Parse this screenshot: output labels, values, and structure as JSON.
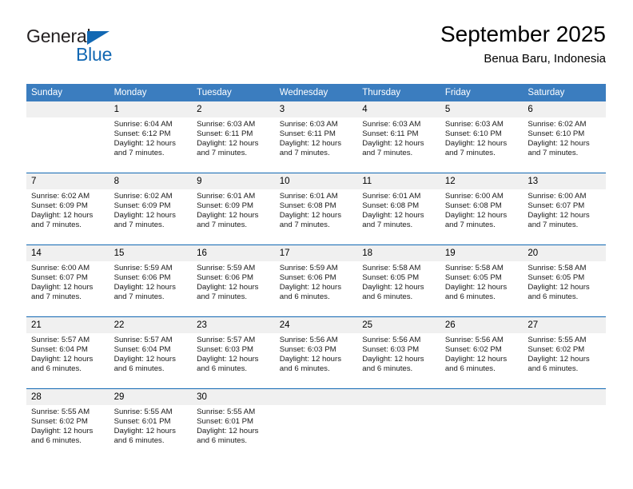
{
  "brand": {
    "word_one": "General",
    "word_two": "Blue",
    "triangle_icon": "blue-triangle-logo-mark",
    "accent_color": "#1268b3"
  },
  "header": {
    "title": "September 2025",
    "subtitle": "Benua Baru, Indonesia"
  },
  "calendar": {
    "header_bg": "#3b7dbf",
    "daynum_bg": "#f0f0f0",
    "weekday_headers": [
      "Sunday",
      "Monday",
      "Tuesday",
      "Wednesday",
      "Thursday",
      "Friday",
      "Saturday"
    ],
    "weeks": [
      [
        {
          "day": "",
          "lines": []
        },
        {
          "day": "1",
          "lines": [
            "Sunrise: 6:04 AM",
            "Sunset: 6:12 PM",
            "Daylight: 12 hours",
            "and 7 minutes."
          ]
        },
        {
          "day": "2",
          "lines": [
            "Sunrise: 6:03 AM",
            "Sunset: 6:11 PM",
            "Daylight: 12 hours",
            "and 7 minutes."
          ]
        },
        {
          "day": "3",
          "lines": [
            "Sunrise: 6:03 AM",
            "Sunset: 6:11 PM",
            "Daylight: 12 hours",
            "and 7 minutes."
          ]
        },
        {
          "day": "4",
          "lines": [
            "Sunrise: 6:03 AM",
            "Sunset: 6:11 PM",
            "Daylight: 12 hours",
            "and 7 minutes."
          ]
        },
        {
          "day": "5",
          "lines": [
            "Sunrise: 6:03 AM",
            "Sunset: 6:10 PM",
            "Daylight: 12 hours",
            "and 7 minutes."
          ]
        },
        {
          "day": "6",
          "lines": [
            "Sunrise: 6:02 AM",
            "Sunset: 6:10 PM",
            "Daylight: 12 hours",
            "and 7 minutes."
          ]
        }
      ],
      [
        {
          "day": "7",
          "lines": [
            "Sunrise: 6:02 AM",
            "Sunset: 6:09 PM",
            "Daylight: 12 hours",
            "and 7 minutes."
          ]
        },
        {
          "day": "8",
          "lines": [
            "Sunrise: 6:02 AM",
            "Sunset: 6:09 PM",
            "Daylight: 12 hours",
            "and 7 minutes."
          ]
        },
        {
          "day": "9",
          "lines": [
            "Sunrise: 6:01 AM",
            "Sunset: 6:09 PM",
            "Daylight: 12 hours",
            "and 7 minutes."
          ]
        },
        {
          "day": "10",
          "lines": [
            "Sunrise: 6:01 AM",
            "Sunset: 6:08 PM",
            "Daylight: 12 hours",
            "and 7 minutes."
          ]
        },
        {
          "day": "11",
          "lines": [
            "Sunrise: 6:01 AM",
            "Sunset: 6:08 PM",
            "Daylight: 12 hours",
            "and 7 minutes."
          ]
        },
        {
          "day": "12",
          "lines": [
            "Sunrise: 6:00 AM",
            "Sunset: 6:08 PM",
            "Daylight: 12 hours",
            "and 7 minutes."
          ]
        },
        {
          "day": "13",
          "lines": [
            "Sunrise: 6:00 AM",
            "Sunset: 6:07 PM",
            "Daylight: 12 hours",
            "and 7 minutes."
          ]
        }
      ],
      [
        {
          "day": "14",
          "lines": [
            "Sunrise: 6:00 AM",
            "Sunset: 6:07 PM",
            "Daylight: 12 hours",
            "and 7 minutes."
          ]
        },
        {
          "day": "15",
          "lines": [
            "Sunrise: 5:59 AM",
            "Sunset: 6:06 PM",
            "Daylight: 12 hours",
            "and 7 minutes."
          ]
        },
        {
          "day": "16",
          "lines": [
            "Sunrise: 5:59 AM",
            "Sunset: 6:06 PM",
            "Daylight: 12 hours",
            "and 7 minutes."
          ]
        },
        {
          "day": "17",
          "lines": [
            "Sunrise: 5:59 AM",
            "Sunset: 6:06 PM",
            "Daylight: 12 hours",
            "and 6 minutes."
          ]
        },
        {
          "day": "18",
          "lines": [
            "Sunrise: 5:58 AM",
            "Sunset: 6:05 PM",
            "Daylight: 12 hours",
            "and 6 minutes."
          ]
        },
        {
          "day": "19",
          "lines": [
            "Sunrise: 5:58 AM",
            "Sunset: 6:05 PM",
            "Daylight: 12 hours",
            "and 6 minutes."
          ]
        },
        {
          "day": "20",
          "lines": [
            "Sunrise: 5:58 AM",
            "Sunset: 6:05 PM",
            "Daylight: 12 hours",
            "and 6 minutes."
          ]
        }
      ],
      [
        {
          "day": "21",
          "lines": [
            "Sunrise: 5:57 AM",
            "Sunset: 6:04 PM",
            "Daylight: 12 hours",
            "and 6 minutes."
          ]
        },
        {
          "day": "22",
          "lines": [
            "Sunrise: 5:57 AM",
            "Sunset: 6:04 PM",
            "Daylight: 12 hours",
            "and 6 minutes."
          ]
        },
        {
          "day": "23",
          "lines": [
            "Sunrise: 5:57 AM",
            "Sunset: 6:03 PM",
            "Daylight: 12 hours",
            "and 6 minutes."
          ]
        },
        {
          "day": "24",
          "lines": [
            "Sunrise: 5:56 AM",
            "Sunset: 6:03 PM",
            "Daylight: 12 hours",
            "and 6 minutes."
          ]
        },
        {
          "day": "25",
          "lines": [
            "Sunrise: 5:56 AM",
            "Sunset: 6:03 PM",
            "Daylight: 12 hours",
            "and 6 minutes."
          ]
        },
        {
          "day": "26",
          "lines": [
            "Sunrise: 5:56 AM",
            "Sunset: 6:02 PM",
            "Daylight: 12 hours",
            "and 6 minutes."
          ]
        },
        {
          "day": "27",
          "lines": [
            "Sunrise: 5:55 AM",
            "Sunset: 6:02 PM",
            "Daylight: 12 hours",
            "and 6 minutes."
          ]
        }
      ],
      [
        {
          "day": "28",
          "lines": [
            "Sunrise: 5:55 AM",
            "Sunset: 6:02 PM",
            "Daylight: 12 hours",
            "and 6 minutes."
          ]
        },
        {
          "day": "29",
          "lines": [
            "Sunrise: 5:55 AM",
            "Sunset: 6:01 PM",
            "Daylight: 12 hours",
            "and 6 minutes."
          ]
        },
        {
          "day": "30",
          "lines": [
            "Sunrise: 5:55 AM",
            "Sunset: 6:01 PM",
            "Daylight: 12 hours",
            "and 6 minutes."
          ]
        },
        {
          "day": "",
          "lines": []
        },
        {
          "day": "",
          "lines": []
        },
        {
          "day": "",
          "lines": []
        },
        {
          "day": "",
          "lines": []
        }
      ]
    ]
  }
}
